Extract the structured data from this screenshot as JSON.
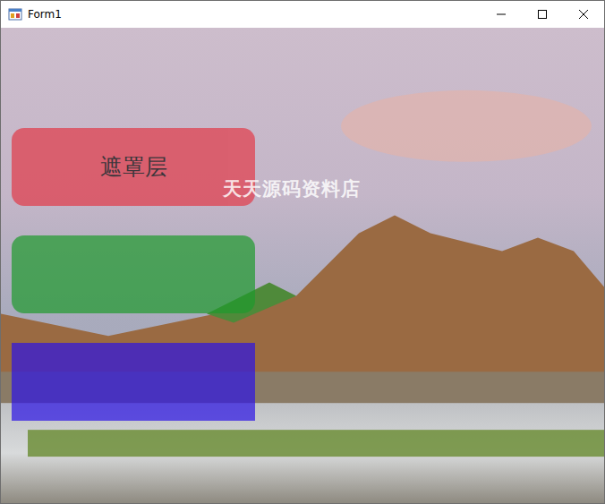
{
  "window": {
    "title": "Form1"
  },
  "watermark": "天天源码资料店",
  "panels": [
    {
      "label": "遮罩层",
      "kind": "rounded",
      "color": "#e23a48"
    },
    {
      "label": "",
      "kind": "rounded",
      "color": "#1e9a2c"
    },
    {
      "label": "",
      "kind": "square",
      "color": "#2c14e6"
    }
  ]
}
